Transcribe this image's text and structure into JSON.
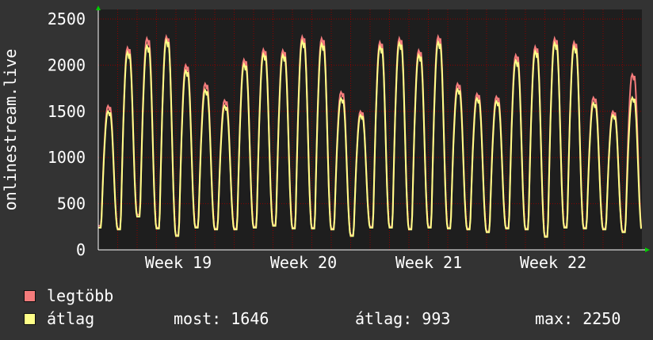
{
  "chart_data": {
    "type": "line",
    "ylabel": "onlinestream.live",
    "ylim": [
      0,
      2500
    ],
    "yticks": [
      0,
      500,
      1000,
      1500,
      2000,
      2500
    ],
    "xticks": [
      "Week 19",
      "Week 20",
      "Week 21",
      "Week 22"
    ],
    "grid": true,
    "colors": {
      "background": "#333333",
      "plot_background": "#1e1e1e",
      "grid": "#8b0000",
      "axis_arrow": "#00cc00",
      "series_max": "#f47c7c",
      "series_avg": "#ffff88"
    },
    "series": [
      {
        "name": "legtöbb",
        "daily_peak": [
          1560,
          2190,
          2290,
          2310,
          2000,
          1800,
          1620,
          2060,
          2170,
          2160,
          2310,
          2290,
          1710,
          1500,
          2250,
          2290,
          2160,
          2310,
          1800,
          1690,
          1660,
          2110,
          2200,
          2290,
          2250,
          1650,
          1500,
          1900
        ],
        "daily_low": [
          260,
          230,
          380,
          240,
          160,
          250,
          230,
          230,
          250,
          270,
          240,
          240,
          230,
          160,
          250,
          250,
          230,
          250,
          240,
          230,
          200,
          240,
          230,
          150,
          250,
          240,
          230,
          200
        ]
      },
      {
        "name": "átlag",
        "daily_peak": [
          1500,
          2140,
          2210,
          2270,
          1940,
          1730,
          1560,
          2010,
          2120,
          2110,
          2260,
          2230,
          1640,
          1460,
          2200,
          2240,
          2110,
          2250,
          1740,
          1640,
          1610,
          2050,
          2150,
          2240,
          2200,
          1590,
          1460,
          1650
        ],
        "daily_low": [
          240,
          220,
          360,
          230,
          150,
          240,
          220,
          220,
          240,
          260,
          230,
          230,
          220,
          150,
          240,
          240,
          220,
          240,
          230,
          220,
          190,
          230,
          220,
          140,
          240,
          230,
          220,
          190
        ]
      }
    ]
  },
  "legend": {
    "max_label": "legtöbb",
    "avg_label": "átlag"
  },
  "stats": {
    "now": "most: 1646",
    "avg": "átlag: 993",
    "max": "max: 2250"
  }
}
